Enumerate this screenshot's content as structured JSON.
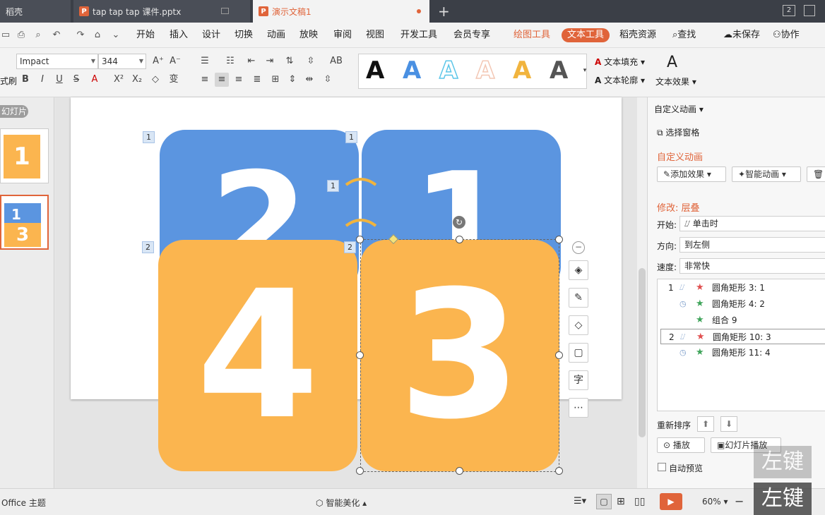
{
  "tabs": [
    {
      "label": "稻壳"
    },
    {
      "label": "tap tap tap 课件.pptx"
    },
    {
      "label": "演示文稿1"
    }
  ],
  "window": {
    "tab_add": "+",
    "page_num": "2"
  },
  "menu": {
    "items": [
      "开始",
      "插入",
      "设计",
      "切换",
      "动画",
      "放映",
      "审阅",
      "视图",
      "开发工具",
      "会员专享"
    ],
    "drawing_tools": "绘图工具",
    "text_tools": "文本工具",
    "docer_resources": "稻壳资源",
    "search": "查找",
    "unsaved": "未保存",
    "collaborate": "协作"
  },
  "ribbon": {
    "font_name": "Impact",
    "font_size": "344",
    "format_painter": "式刷",
    "text_fill": "文本填充",
    "text_outline": "文本轮廓",
    "text_effect": "文本效果",
    "style_letters": [
      "A",
      "A",
      "A",
      "A",
      "A",
      "A"
    ],
    "style_colors": [
      "#111111",
      "#4a90e2",
      "#5cc6e8",
      "#f3c7b4",
      "#f1b43e",
      "#555555"
    ]
  },
  "left_panel": {
    "slides_tab": "幻灯片",
    "thumb1_num": "1",
    "thumb2_nums": [
      "1",
      "3"
    ]
  },
  "slide": {
    "cards": [
      {
        "num": "2",
        "color": "#5b95e0"
      },
      {
        "num": "1",
        "color": "#5b95e0"
      },
      {
        "num": "4",
        "color": "#fbb54f"
      },
      {
        "num": "3",
        "color": "#fbb54f"
      }
    ],
    "badges": [
      "1",
      "1",
      "1",
      "2",
      "2"
    ]
  },
  "side_tools": [
    "minus-icon",
    "layers-icon",
    "pen-icon",
    "fill-icon",
    "outline-icon",
    "text-wrap-icon",
    "more-icon"
  ],
  "right_panel": {
    "header": "自定义动画",
    "select_pane": "选择窗格",
    "section_title": "自定义动画",
    "add_effect": "添加效果",
    "smart_anim": "智能动画",
    "modify": "修改: 层叠",
    "start_label": "开始:",
    "start_value": "单击时",
    "direction_label": "方向:",
    "direction_value": "到左侧",
    "speed_label": "速度:",
    "speed_value": "非常快",
    "anim_items": [
      {
        "index": "1",
        "name": "圆角矩形 3: 1",
        "star": "red"
      },
      {
        "index": "",
        "name": "圆角矩形 4: 2",
        "star": "green"
      },
      {
        "index": "",
        "name": "组合 9",
        "star": "green"
      },
      {
        "index": "2",
        "name": "圆角矩形 10: 3",
        "star": "red"
      },
      {
        "index": "",
        "name": "圆角矩形 11: 4",
        "star": "green"
      }
    ],
    "reorder": "重新排序",
    "play": "播放",
    "slideshow": "幻灯片播放",
    "auto_preview": "自动预览"
  },
  "status": {
    "theme": "Office 主题",
    "beautify": "智能美化",
    "zoom": "60%"
  },
  "watermark": {
    "top": "左键",
    "bottom": "左键"
  }
}
